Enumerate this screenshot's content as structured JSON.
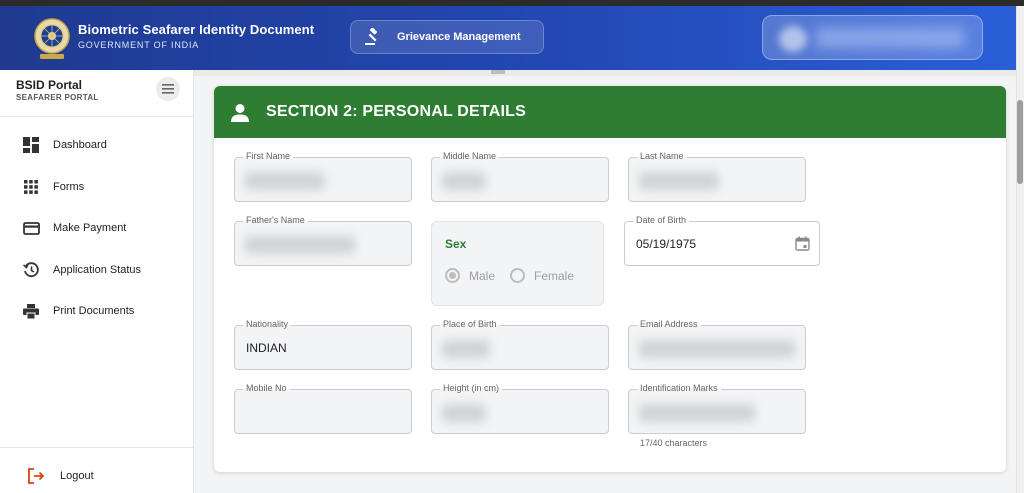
{
  "header": {
    "title": "Biometric Seafarer Identity Document",
    "subtitle": "GOVERNMENT OF INDIA",
    "grievance_label": "Grievance Management",
    "brand_color": "#2348b5"
  },
  "sidebar": {
    "portal_title": "BSID Portal",
    "portal_subtitle": "SEAFARER PORTAL",
    "items": [
      {
        "label": "Dashboard",
        "icon": "dashboard-icon"
      },
      {
        "label": "Forms",
        "icon": "grid-icon"
      },
      {
        "label": "Make Payment",
        "icon": "credit-card-icon"
      },
      {
        "label": "Application Status",
        "icon": "history-icon"
      },
      {
        "label": "Print Documents",
        "icon": "printer-icon"
      }
    ],
    "logout_label": "Logout"
  },
  "section": {
    "title": "SECTION 2: PERSONAL DETAILS",
    "header_color": "#2e7d32",
    "fields": {
      "first_name": {
        "label": "First Name",
        "value": ""
      },
      "middle_name": {
        "label": "Middle Name",
        "value": ""
      },
      "last_name": {
        "label": "Last Name",
        "value": ""
      },
      "fathers_name": {
        "label": "Father's Name",
        "value": ""
      },
      "date_of_birth": {
        "label": "Date of Birth",
        "value": "05/19/1975"
      },
      "nationality": {
        "label": "Nationality",
        "value": "INDIAN"
      },
      "place_of_birth": {
        "label": "Place of Birth",
        "value": ""
      },
      "email": {
        "label": "Email Address",
        "value": ""
      },
      "mobile": {
        "label": "Mobile No",
        "value": ""
      },
      "height": {
        "label": "Height (in cm)",
        "value": ""
      },
      "identification_marks": {
        "label": "Identification Marks",
        "value": "",
        "counter": "17/40 characters"
      }
    },
    "sex": {
      "label": "Sex",
      "options": [
        "Male",
        "Female"
      ],
      "selected": "Male"
    }
  }
}
